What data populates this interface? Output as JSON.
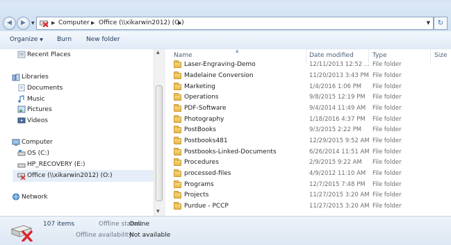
{
  "address": {
    "crumbs": [
      "Computer",
      "Office (\\\\xikarwin2012) (O:)"
    ]
  },
  "toolbar": {
    "organize": "Organize",
    "burn": "Burn",
    "new_folder": "New folder"
  },
  "nav": {
    "recent_places": "Recent Places",
    "libraries": "Libraries",
    "documents": "Documents",
    "music": "Music",
    "pictures": "Pictures",
    "videos": "Videos",
    "computer": "Computer",
    "os": "OS (C:)",
    "recovery": "HP_RECOVERY (E:)",
    "office": "Office (\\\\xikarwin2012) (O:)",
    "network": "Network"
  },
  "columns": {
    "name": "Name",
    "date": "Date modified",
    "type": "Type",
    "size": "Size"
  },
  "files": [
    {
      "name": "Laser-Engraving-Demo",
      "date": "12/11/2013 12:52 ...",
      "type": "File folder"
    },
    {
      "name": "Madelaine Conversion",
      "date": "11/20/2013 3:43 PM",
      "type": "File folder"
    },
    {
      "name": "Marketing",
      "date": "1/4/2016 1:06 PM",
      "type": "File folder"
    },
    {
      "name": "Operations",
      "date": "9/8/2015 12:19 PM",
      "type": "File folder"
    },
    {
      "name": "PDF-Software",
      "date": "9/4/2014 11:49 AM",
      "type": "File folder"
    },
    {
      "name": "Photography",
      "date": "1/18/2016 4:37 PM",
      "type": "File folder"
    },
    {
      "name": "PostBooks",
      "date": "9/3/2015 2:22 PM",
      "type": "File folder"
    },
    {
      "name": "Postbooks481",
      "date": "12/29/2015 9:52 AM",
      "type": "File folder"
    },
    {
      "name": "Postbooks-Linked-Documents",
      "date": "6/26/2014 11:51 AM",
      "type": "File folder"
    },
    {
      "name": "Procedures",
      "date": "2/9/2015 9:22 AM",
      "type": "File folder"
    },
    {
      "name": "processed-files",
      "date": "4/9/2012 11:10 AM",
      "type": "File folder"
    },
    {
      "name": "Programs",
      "date": "12/7/2015 7:48 PM",
      "type": "File folder"
    },
    {
      "name": "Projects",
      "date": "11/27/2015 3:20 AM",
      "type": "File folder"
    },
    {
      "name": "Purdue - PCCP",
      "date": "11/27/2015 3:20 AM",
      "type": "File folder"
    }
  ],
  "status": {
    "items": "107 items",
    "offline_status_label": "Offline status:",
    "offline_status_value": "Online",
    "offline_avail_label": "Offline availability:",
    "offline_avail_value": "Not available"
  },
  "colors": {
    "accent": "#3a6ea5",
    "selection": "#e5eef8",
    "disconnect": "#d8282a"
  }
}
